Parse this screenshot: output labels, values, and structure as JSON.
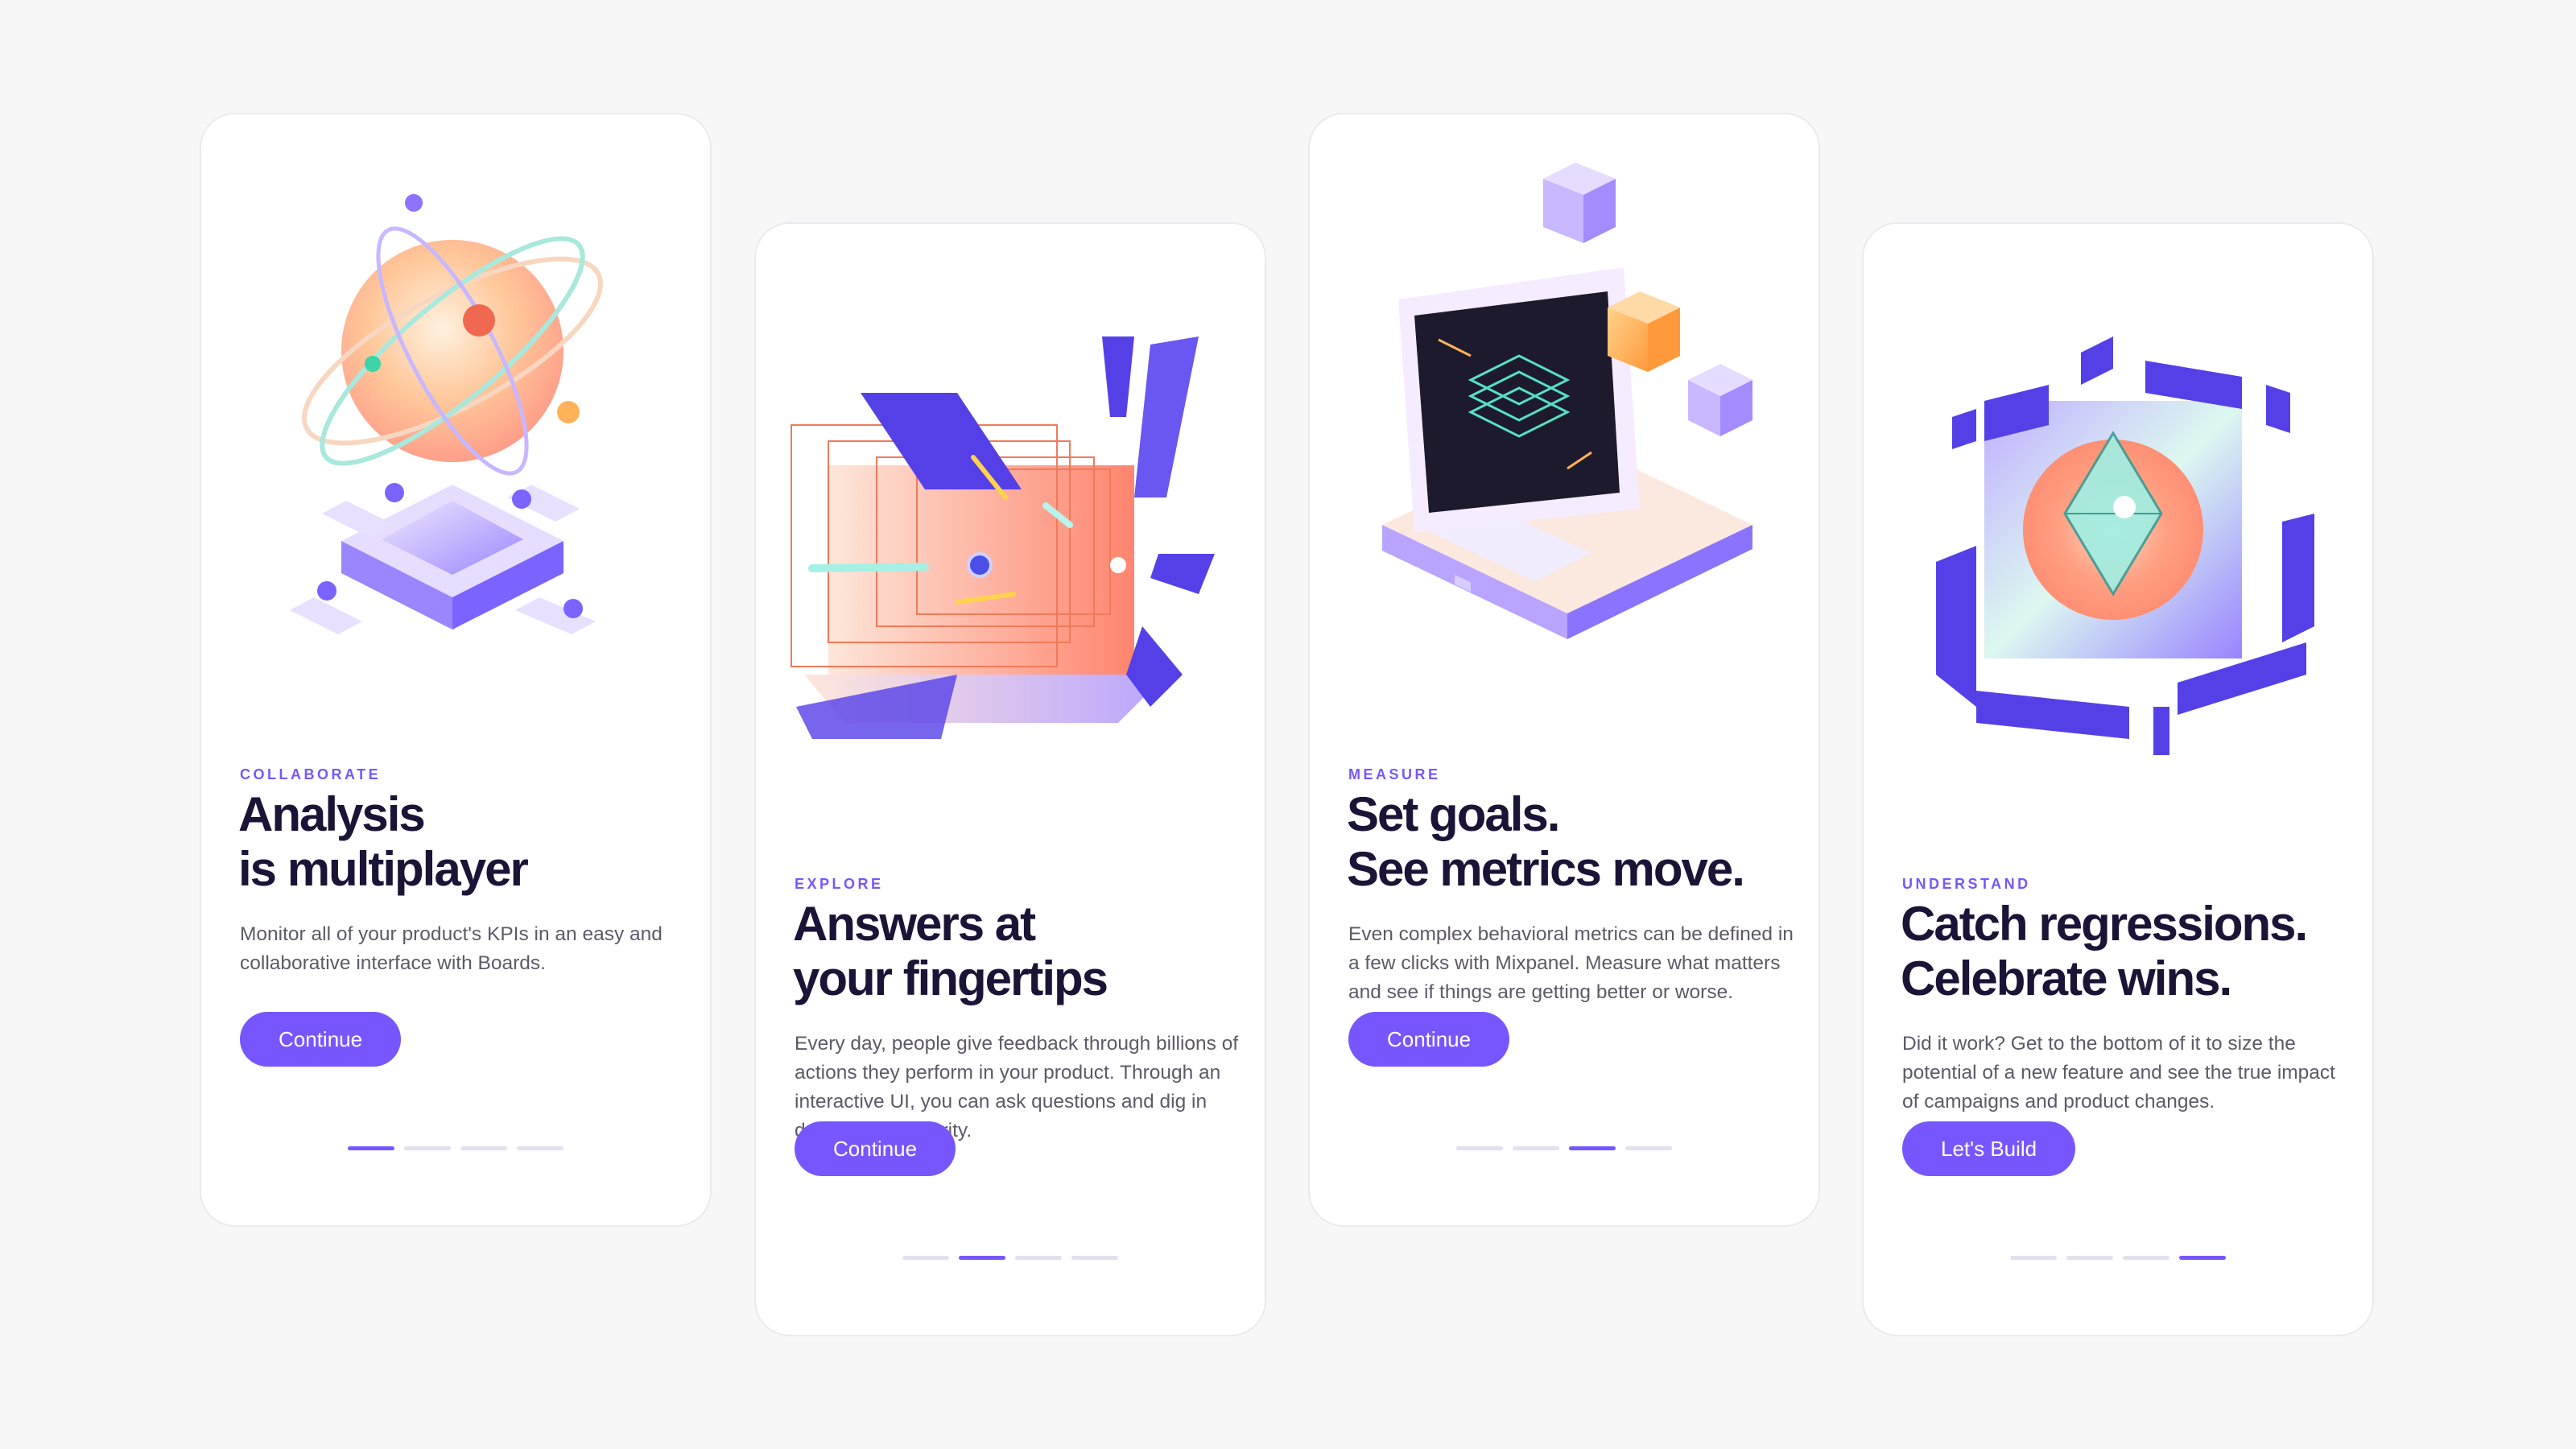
{
  "colors": {
    "accent": "#7856ff",
    "title": "#1b1436",
    "body": "#5d5966",
    "dot_inactive": "#e4e0ef"
  },
  "cards": [
    {
      "eyebrow": "COLLABORATE",
      "title": "Analysis\nis multiplayer",
      "description": "Monitor all of your product's KPIs in an easy and collaborative interface with Boards.",
      "button": "Continue",
      "active_dot": 1,
      "illustration": "orbiting-planet-boards"
    },
    {
      "eyebrow": "EXPLORE",
      "title": "Answers at\nyour fingertips",
      "description": "Every day, people give feedback through billions of actions they perform in your product. Through an interactive UI, you can ask questions and dig in deeper to get clarity.",
      "button": "Continue",
      "active_dot": 2,
      "illustration": "light-tunnel"
    },
    {
      "eyebrow": "MEASURE",
      "title": "Set goals.\nSee metrics move.",
      "description": "Even complex behavioral metrics can be defined in a few clicks with Mixpanel. Measure what matters and see if things are getting better or worse.",
      "button": "Continue",
      "active_dot": 3,
      "illustration": "retro-computer-cubes"
    },
    {
      "eyebrow": "UNDERSTAND",
      "title": "Catch regressions.\nCelebrate wins.",
      "description": "Did it work? Get to the bottom of it to size the potential of a new feature and see the true impact of campaigns and product changes.",
      "button": "Let's Build",
      "active_dot": 4,
      "illustration": "crystal-cube"
    }
  ]
}
